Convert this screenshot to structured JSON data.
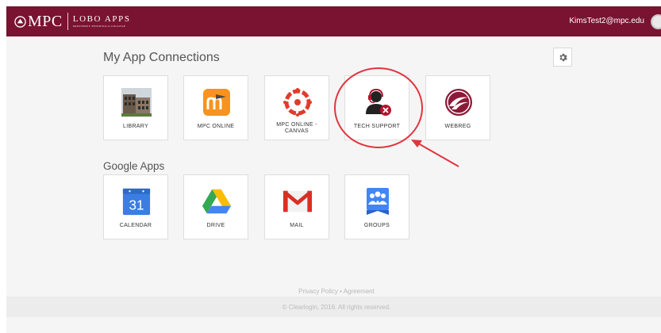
{
  "header": {
    "brand": "MPC",
    "app_name": "LOBO APPS",
    "subtitle": "MONTEREY PENINSULA COLLEGE",
    "user_email": "KimsTest2@mpc.edu",
    "bar_color": "#7a1231"
  },
  "my_apps": {
    "title": "My App Connections",
    "tiles": [
      {
        "label": "LIBRARY",
        "icon": "library-building-icon"
      },
      {
        "label": "MPC ONLINE",
        "icon": "moodle-icon"
      },
      {
        "label": "MPC ONLINE -",
        "label2": "CANVAS",
        "icon": "canvas-icon"
      },
      {
        "label": "TECH SUPPORT",
        "icon": "tech-support-headset-icon"
      },
      {
        "label": "WEBREG",
        "icon": "webreg-icon"
      }
    ]
  },
  "google_apps": {
    "title": "Google Apps",
    "tiles": [
      {
        "label": "CALENDAR",
        "icon": "google-calendar-icon",
        "day": "31"
      },
      {
        "label": "DRIVE",
        "icon": "google-drive-icon"
      },
      {
        "label": "MAIL",
        "icon": "gmail-icon"
      },
      {
        "label": "GROUPS",
        "icon": "google-groups-icon"
      }
    ]
  },
  "footer": {
    "links": "Privacy Policy • Agreement",
    "copyright": "© Clearlogin, 2016. All rights reserved."
  },
  "annotation_color": "#e0353f"
}
